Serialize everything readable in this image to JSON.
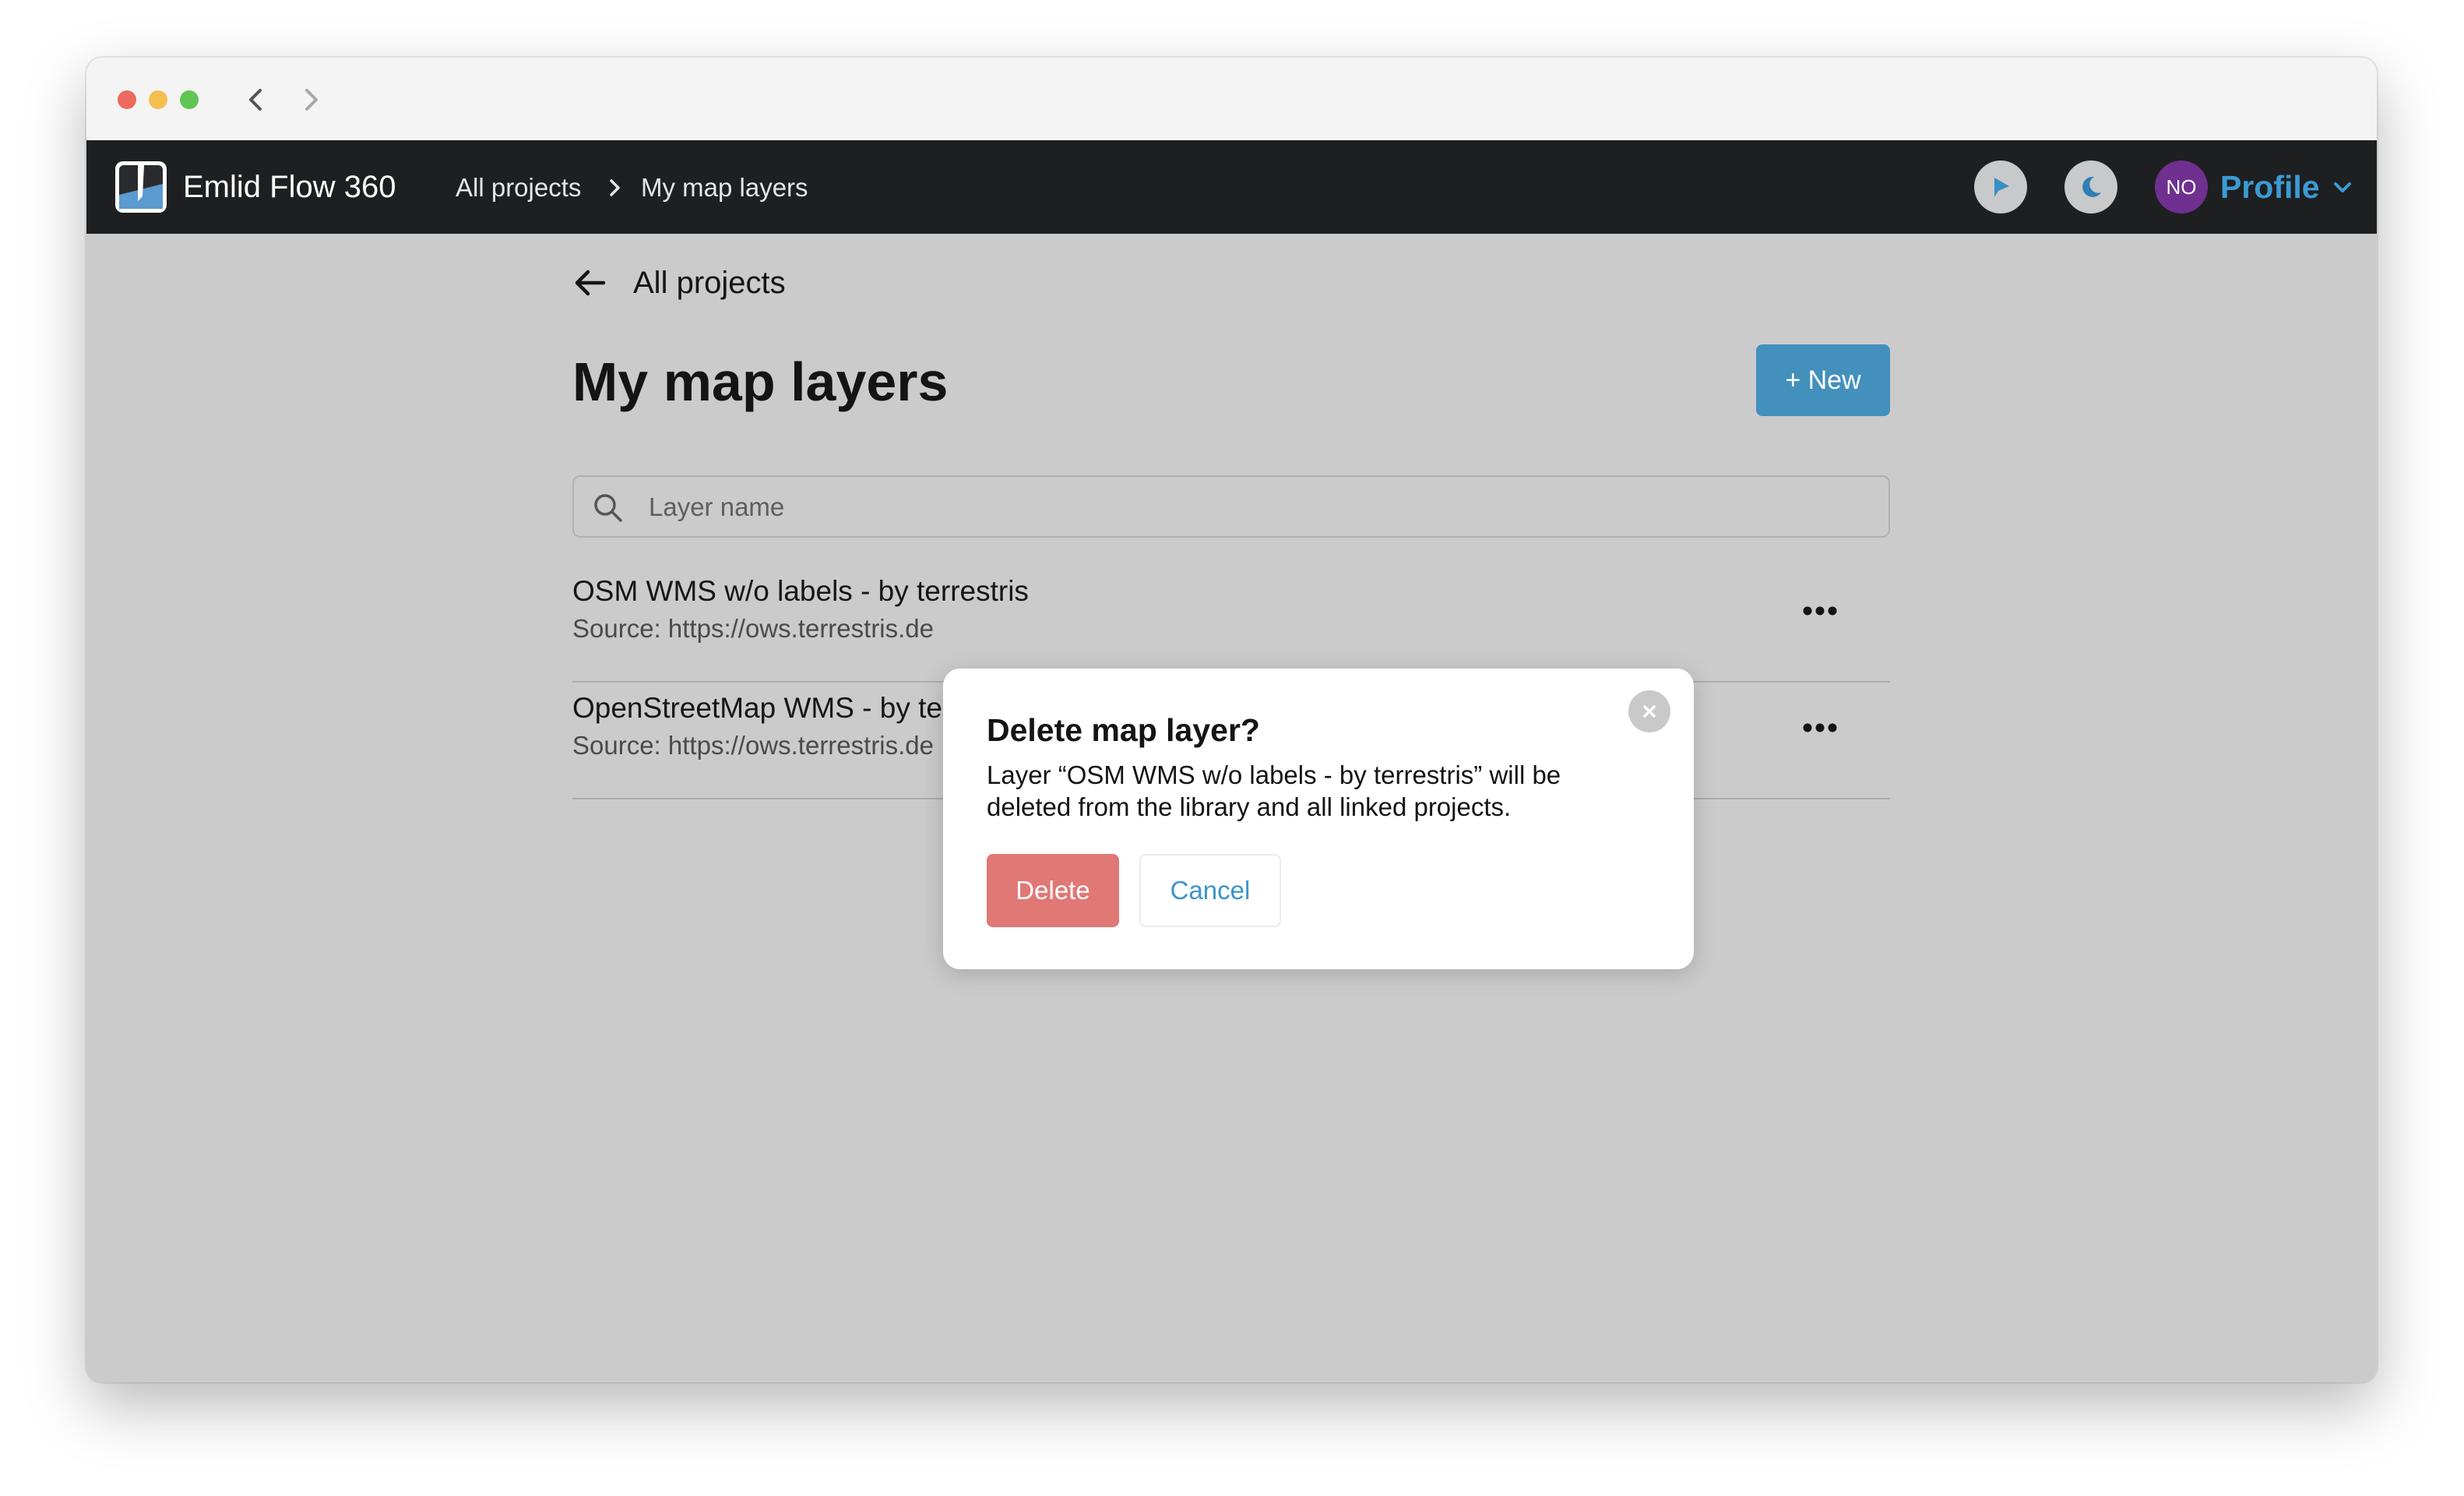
{
  "app": {
    "name": "Emlid Flow 360",
    "breadcrumb": [
      "All projects",
      "My map layers"
    ]
  },
  "header": {
    "avatar_initials": "NO",
    "profile_label": "Profile",
    "accent_color": "#3b9bd4",
    "icons": [
      "play-icon",
      "moon-icon",
      "chevron-down-icon"
    ]
  },
  "page": {
    "back_label": "All projects",
    "title": "My map layers",
    "new_button": "+ New",
    "search_placeholder": "Layer name"
  },
  "layers": [
    {
      "name": "OSM WMS w/o labels - by terrestris",
      "source": "Source: https://ows.terrestris.de"
    },
    {
      "name": "OpenStreetMap WMS - by terrestris",
      "source": "Source: https://ows.terrestris.de"
    }
  ],
  "modal": {
    "title": "Delete map layer?",
    "message": "Layer “OSM WMS w/o labels - by terrestris” will be deleted from the library and all linked projects.",
    "delete_label": "Delete",
    "cancel_label": "Cancel",
    "delete_color": "#e07875"
  }
}
